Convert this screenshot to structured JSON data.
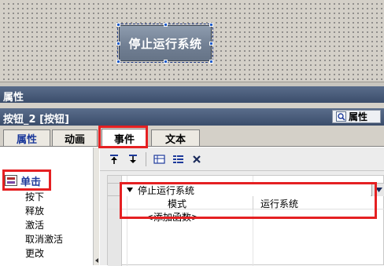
{
  "canvas": {
    "button_label": "停止运行系统"
  },
  "panel": {
    "title": "属性",
    "object_name": "按钮_2 [按钮]",
    "properties_label": "属性"
  },
  "tabs": [
    {
      "label": "属性"
    },
    {
      "label": "动画"
    },
    {
      "label": "事件"
    },
    {
      "label": "文本"
    }
  ],
  "events": {
    "selected": "单击",
    "items": [
      "按下",
      "释放",
      "激活",
      "取消激活",
      "更改"
    ]
  },
  "function_list": {
    "function_name": "停止运行系统",
    "param_name": "模式",
    "param_value": "运行系统",
    "add_function": "<添加函数>"
  },
  "toolbar": {
    "icons": [
      "move-up-icon",
      "move-down-icon",
      "insert-row-icon",
      "list-icon",
      "delete-icon"
    ]
  },
  "colors": {
    "highlight": "#e52022",
    "title_bar": "#3b4d6b",
    "accent_text": "#1d3a9b"
  }
}
